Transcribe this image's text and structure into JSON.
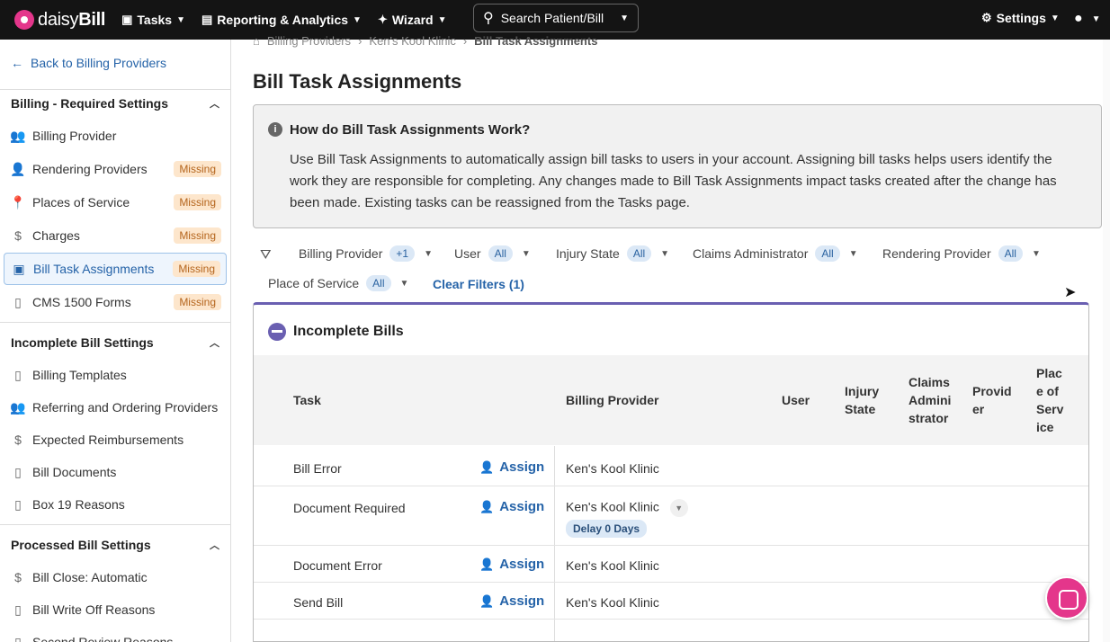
{
  "topnav": {
    "logo_text_light": "daisy",
    "logo_text_bold": "Bill",
    "tasks": "Tasks",
    "reporting": "Reporting & Analytics",
    "wizard": "Wizard",
    "search": "Search Patient/Bill",
    "settings": "Settings"
  },
  "sidebar": {
    "back": "Back to Billing Providers",
    "sections": [
      {
        "title": "Billing - Required Settings"
      },
      {
        "title": "Incomplete Bill Settings"
      },
      {
        "title": "Processed Bill Settings"
      }
    ],
    "required_items": [
      {
        "label": "Billing Provider",
        "badge": ""
      },
      {
        "label": "Rendering Providers",
        "badge": "Missing"
      },
      {
        "label": "Places of Service",
        "badge": "Missing"
      },
      {
        "label": "Charges",
        "badge": "Missing"
      },
      {
        "label": "Bill Task Assignments",
        "badge": "Missing"
      },
      {
        "label": "CMS 1500 Forms",
        "badge": "Missing"
      }
    ],
    "incomplete_items": [
      {
        "label": "Billing Templates"
      },
      {
        "label": "Referring and Ordering Providers"
      },
      {
        "label": "Expected Reimbursements"
      },
      {
        "label": "Bill Documents"
      },
      {
        "label": "Box 19 Reasons"
      }
    ],
    "processed_items": [
      {
        "label": "Bill Close: Automatic"
      },
      {
        "label": "Bill Write Off Reasons"
      },
      {
        "label": "Second Review Reasons"
      }
    ]
  },
  "breadcrumb": {
    "level1": "Billing Providers",
    "level2": "Ken's Kool Klinic",
    "current": "Bill Task Assignments"
  },
  "page_title": "Bill Task Assignments",
  "info": {
    "title": "How do Bill Task Assignments Work?",
    "body": "Use Bill Task Assignments to automatically assign bill tasks to users in your account. Assigning bill tasks helps users identify the work they are responsible for completing. Any changes made to Bill Task Assignments impact tasks created after the change has been made. Existing tasks can be reassigned from the Tasks page."
  },
  "filters": [
    {
      "label": "Billing Provider",
      "badge": "+1"
    },
    {
      "label": "User",
      "badge": "All"
    },
    {
      "label": "Injury State",
      "badge": "All"
    },
    {
      "label": "Claims Administrator",
      "badge": "All"
    },
    {
      "label": "Rendering Provider",
      "badge": "All"
    },
    {
      "label": "Place of Service",
      "badge": "All"
    }
  ],
  "clear_filters": "Clear Filters (1)",
  "panel": {
    "title": "Incomplete Bills",
    "columns": {
      "task": "Task",
      "billing_provider": "Billing Provider",
      "user": "User",
      "injury_state": "Injury State",
      "claims_admin": "Claims Administrator",
      "provider": "Provider",
      "place_of_service": "Place of Service"
    },
    "assign_label": "Assign",
    "rows": [
      {
        "task": "Bill Error",
        "provider": "Ken's Kool Klinic"
      },
      {
        "task": "Document Required",
        "provider": "Ken's Kool Klinic",
        "delay": "Delay 0 Days"
      },
      {
        "task": "Document Error",
        "provider": "Ken's Kool Klinic"
      },
      {
        "task": "Send Bill",
        "provider": "Ken's Kool Klinic"
      }
    ]
  }
}
